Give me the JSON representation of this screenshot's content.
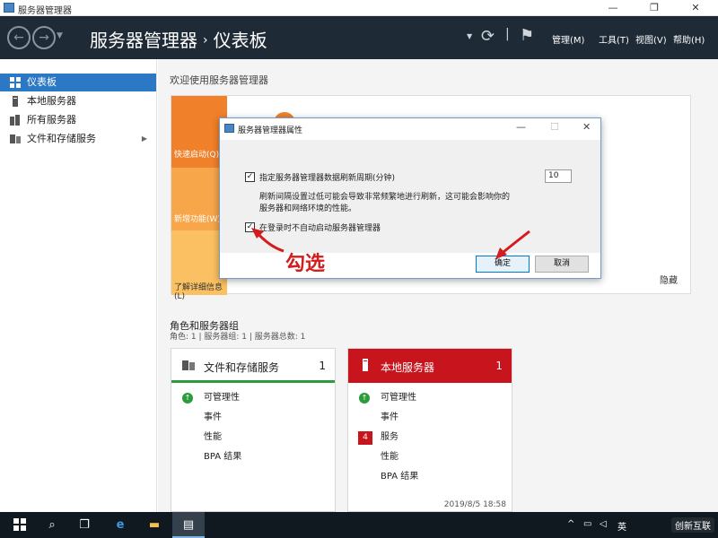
{
  "window": {
    "title": "服务器管理器",
    "minimize": "—",
    "maximize": "❐",
    "close": "✕"
  },
  "header": {
    "app_name": "服务器管理器",
    "separator": "›",
    "page": "仪表板",
    "menus": [
      "管理(M)",
      "工具(T)",
      "视图(V)",
      "帮助(H)"
    ],
    "refresh_icon": "⟳",
    "flag_icon": "⚑"
  },
  "sidebar": {
    "items": [
      {
        "label": "仪表板",
        "icon": "dashboard-grid-icon",
        "active": true
      },
      {
        "label": "本地服务器",
        "icon": "server-icon"
      },
      {
        "label": "所有服务器",
        "icon": "servers-icon"
      },
      {
        "label": "文件和存储服务",
        "icon": "storage-icon",
        "has_arrow": true
      }
    ]
  },
  "welcome": {
    "title": "欢迎使用服务器管理器",
    "quick_start": "快速启动(Q)",
    "whats_new": "新增功能(W)",
    "learn_more": "了解详细信息(L)",
    "hide": "隐藏"
  },
  "roles": {
    "title": "角色和服务器组",
    "subtitle": "角色: 1 | 服务器组: 1 | 服务器总数: 1",
    "cards": [
      {
        "title": "文件和存储服务",
        "count": "1",
        "rows": [
          "可管理性",
          "事件",
          "性能",
          "BPA 结果"
        ]
      },
      {
        "title": "本地服务器",
        "count": "1",
        "rows": [
          "可管理性",
          "事件",
          "服务",
          "性能",
          "BPA 结果"
        ],
        "badge": "4",
        "timestamp": "2019/8/5 18:58"
      }
    ]
  },
  "dialog": {
    "title": "服务器管理器属性",
    "refresh_label": "指定服务器管理器数据刷新周期(分钟)",
    "refresh_value": "10",
    "note_line1": "刷新间隔设置过低可能会导致非常频繁地进行刷新，这可能会影响你的",
    "note_line2": "服务器和网络环境的性能。",
    "autostart_label": "在登录时不自动启动服务器管理器",
    "ok": "确定",
    "cancel": "取消",
    "checkbox_mark": "✓"
  },
  "annotation": {
    "text": "勾选",
    "color": "#d41c1c"
  },
  "taskbar": {
    "tray_ime": "英",
    "tray_up": "^",
    "watermark": "创新互联"
  },
  "colors": {
    "header_bg": "#1e2a36",
    "active_blue": "#2b78c5",
    "orange": "#f0812a",
    "light_orange": "#f7a64a",
    "local_server_red": "#c8141c",
    "ok_green": "#2b9c3c"
  }
}
